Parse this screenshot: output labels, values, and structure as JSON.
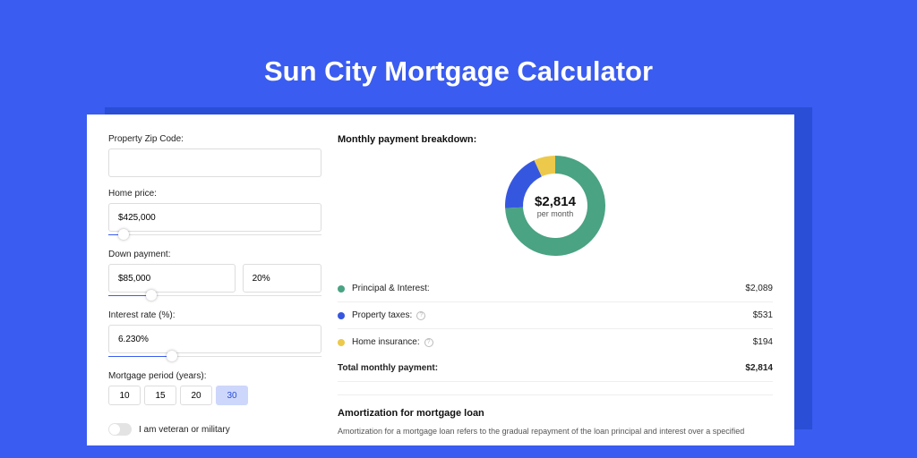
{
  "title": "Sun City Mortgage Calculator",
  "form": {
    "zip_label": "Property Zip Code:",
    "zip_value": "",
    "home_price_label": "Home price:",
    "home_price_value": "$425,000",
    "home_price_slider_pct": 7,
    "down_label": "Down payment:",
    "down_amount": "$85,000",
    "down_pct": "20%",
    "down_slider_pct": 20,
    "rate_label": "Interest rate (%):",
    "rate_value": "6.230%",
    "rate_slider_pct": 30,
    "period_label": "Mortgage period (years):",
    "periods": [
      "10",
      "15",
      "20",
      "30"
    ],
    "period_selected": "30",
    "vet_label": "I am veteran or military"
  },
  "breakdown": {
    "title": "Monthly payment breakdown:",
    "center_value": "$2,814",
    "center_sub": "per month",
    "items": [
      {
        "label": "Principal & Interest:",
        "value": "$2,089",
        "color": "#4aa383",
        "help": false
      },
      {
        "label": "Property taxes:",
        "value": "$531",
        "color": "#3557e0",
        "help": true
      },
      {
        "label": "Home insurance:",
        "value": "$194",
        "color": "#ecc94b",
        "help": true
      }
    ],
    "total_label": "Total monthly payment:",
    "total_value": "$2,814"
  },
  "chart_data": {
    "type": "pie",
    "title": "Monthly payment breakdown",
    "series": [
      {
        "name": "Principal & Interest",
        "value": 2089,
        "color": "#4aa383"
      },
      {
        "name": "Property taxes",
        "value": 531,
        "color": "#3557e0"
      },
      {
        "name": "Home insurance",
        "value": 194,
        "color": "#ecc94b"
      }
    ],
    "total": 2814
  },
  "amort": {
    "title": "Amortization for mortgage loan",
    "body": "Amortization for a mortgage loan refers to the gradual repayment of the loan principal and interest over a specified"
  }
}
